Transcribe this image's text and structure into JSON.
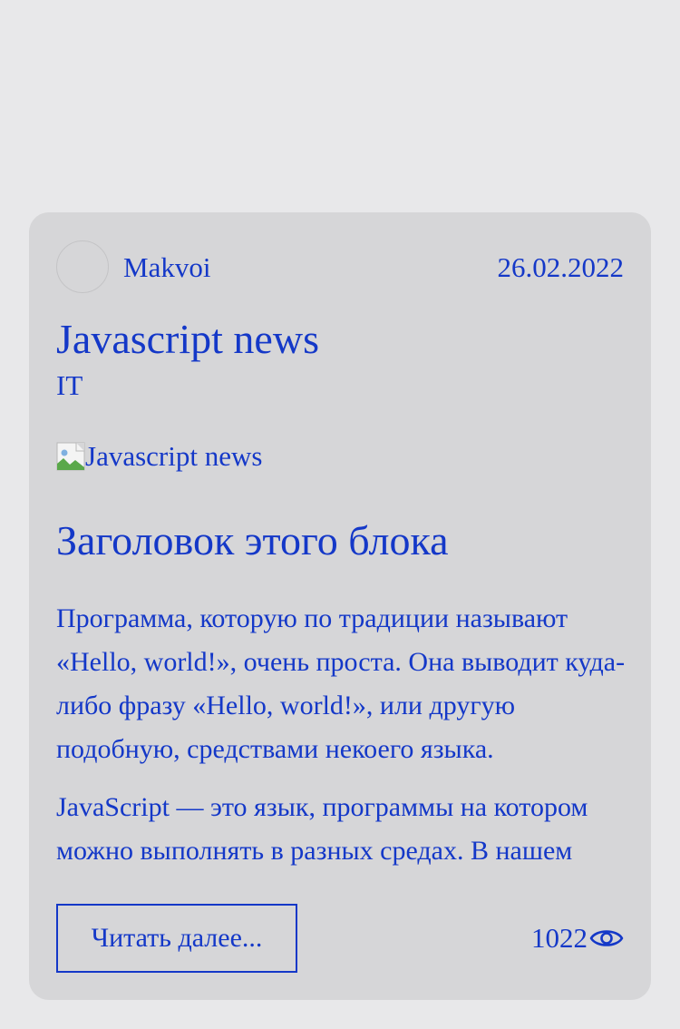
{
  "post": {
    "author": "Makvoi",
    "date": "26.02.2022",
    "title": "Javascript news",
    "category": "IT",
    "image_alt": "Javascript news",
    "block_heading": "Заголовок этого блока",
    "paragraphs": [
      "Программа, которую по традиции называют «Hello, world!», очень проста. Она выводит куда-либо фразу «Hello, world!», или другую подобную, средствами некоего языка.",
      "JavaScript — это язык, программы на котором можно выполнять в разных средах. В нашем"
    ],
    "read_more_label": "Читать далее...",
    "views": "1022"
  },
  "icons": {
    "views": "eye-icon",
    "image": "broken-image-icon"
  },
  "colors": {
    "accent": "#1438c8",
    "page_bg": "#e8e8ea",
    "card_bg": "#d6d6d8"
  }
}
